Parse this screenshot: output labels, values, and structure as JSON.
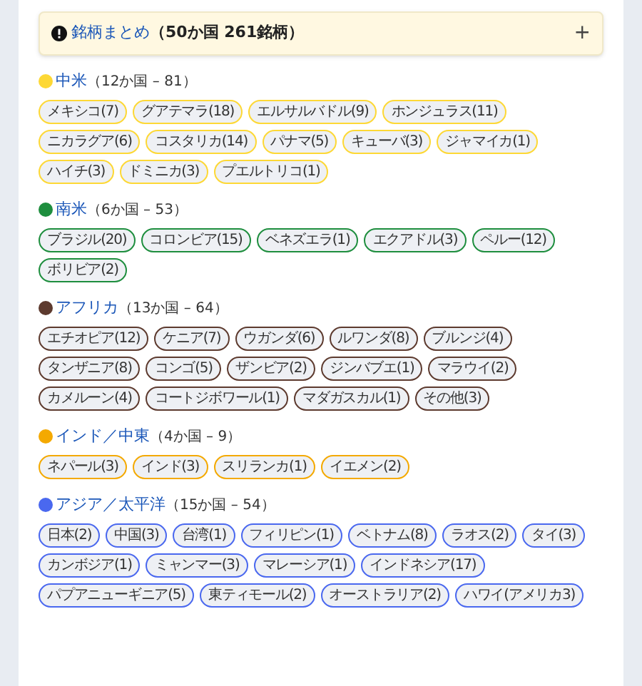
{
  "summary": {
    "title": "銘柄まとめ",
    "count": "（50か国 261銘柄）",
    "toggle": "+"
  },
  "regions": [
    {
      "name": "中米",
      "count": "（12か国 – 81）",
      "color": "#fdd835",
      "countries": [
        "メキシコ(7)",
        "グアテマラ(18)",
        "エルサルバドル(9)",
        "ホンジュラス(11)",
        "ニカラグア(6)",
        "コスタリカ(14)",
        "パナマ(5)",
        "キューバ(3)",
        "ジャマイカ(1)",
        "ハイチ(3)",
        "ドミニカ(3)",
        "プエルトリコ(1)"
      ]
    },
    {
      "name": "南米",
      "count": "（6か国 – 53）",
      "color": "#1e8e3e",
      "countries": [
        "ブラジル(20)",
        "コロンビア(15)",
        "ベネズエラ(1)",
        "エクアドル(3)",
        "ペルー(12)",
        "ボリビア(2)"
      ]
    },
    {
      "name": "アフリカ",
      "count": "（13か国 – 64）",
      "color": "#5d3a2e",
      "countries": [
        "エチオピア(12)",
        "ケニア(7)",
        "ウガンダ(6)",
        "ルワンダ(8)",
        "ブルンジ(4)",
        "タンザニア(8)",
        "コンゴ(5)",
        "ザンビア(2)",
        "ジンバブエ(1)",
        "マラウイ(2)",
        "カメルーン(4)",
        "コートジボワール(1)",
        "マダガスカル(1)",
        "その他(3)"
      ]
    },
    {
      "name": "インド／中東",
      "count": "（4か国 – 9）",
      "color": "#f4a900",
      "countries": [
        "ネパール(3)",
        "インド(3)",
        "スリランカ(1)",
        "イエメン(2)"
      ]
    },
    {
      "name": "アジア／太平洋",
      "count": "（15か国 – 54）",
      "color": "#4a68ef",
      "countries": [
        "日本(2)",
        "中国(3)",
        "台湾(1)",
        "フィリピン(1)",
        "ベトナム(8)",
        "ラオス(2)",
        "タイ(3)",
        "カンボジア(1)",
        "ミャンマー(3)",
        "マレーシア(1)",
        "インドネシア(17)",
        "パプアニューギニア(5)",
        "東ティモール(2)",
        "オーストラリア(2)",
        "ハワイ(アメリカ3)"
      ]
    }
  ]
}
